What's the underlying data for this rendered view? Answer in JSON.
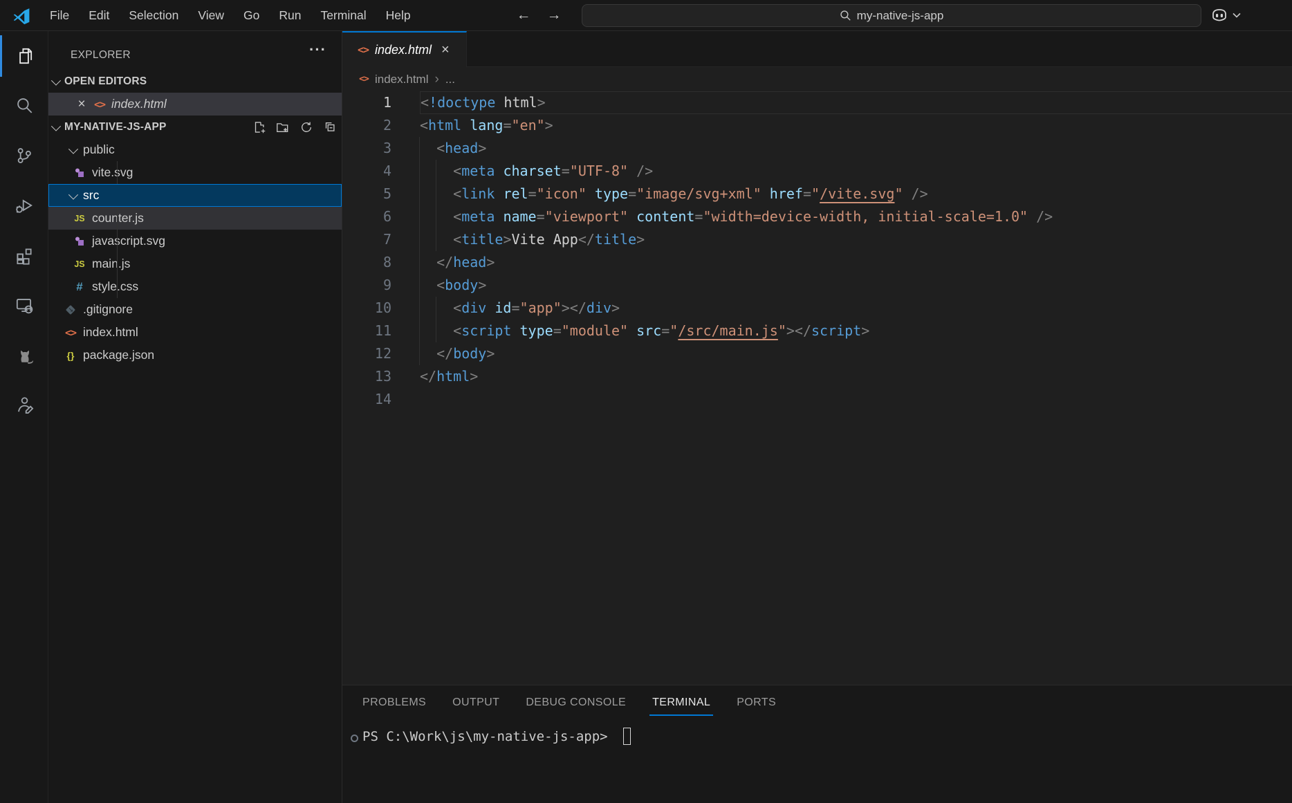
{
  "titlebar": {
    "menus": [
      "File",
      "Edit",
      "Selection",
      "View",
      "Go",
      "Run",
      "Terminal",
      "Help"
    ],
    "search_value": "my-native-js-app",
    "back_arrow": "←",
    "forward_arrow": "→"
  },
  "activity_bar": [
    {
      "name": "explorer",
      "active": true
    },
    {
      "name": "search",
      "active": false
    },
    {
      "name": "source-control",
      "active": false
    },
    {
      "name": "run-debug",
      "active": false
    },
    {
      "name": "extensions",
      "active": false
    },
    {
      "name": "remote-explorer",
      "active": false
    },
    {
      "name": "cat",
      "active": false
    },
    {
      "name": "person",
      "active": false
    }
  ],
  "sidebar": {
    "title": "EXPLORER",
    "more_actions": "···",
    "open_editors": {
      "label": "OPEN EDITORS",
      "items": [
        {
          "icon": "html",
          "label": "index.html",
          "preview": true
        }
      ]
    },
    "project": {
      "label": "MY-NATIVE-JS-APP",
      "actions": [
        "new-file",
        "new-folder",
        "refresh",
        "collapse-all"
      ],
      "tree": [
        {
          "kind": "folder",
          "icon": "chevron-down",
          "label": "public",
          "depth": 0,
          "state": ""
        },
        {
          "kind": "file",
          "icon": "svg",
          "label": "vite.svg",
          "depth": 1,
          "state": ""
        },
        {
          "kind": "folder",
          "icon": "chevron-down",
          "label": "src",
          "depth": 0,
          "state": "selected"
        },
        {
          "kind": "file",
          "icon": "js",
          "label": "counter.js",
          "depth": 1,
          "state": "highlight"
        },
        {
          "kind": "file",
          "icon": "svg",
          "label": "javascript.svg",
          "depth": 1,
          "state": ""
        },
        {
          "kind": "file",
          "icon": "js",
          "label": "main.js",
          "depth": 1,
          "state": ""
        },
        {
          "kind": "file",
          "icon": "css",
          "label": "style.css",
          "depth": 1,
          "state": ""
        },
        {
          "kind": "file",
          "icon": "git",
          "label": ".gitignore",
          "depth": 0,
          "state": ""
        },
        {
          "kind": "file",
          "icon": "html",
          "label": "index.html",
          "depth": 0,
          "state": ""
        },
        {
          "kind": "file",
          "icon": "json",
          "label": "package.json",
          "depth": 0,
          "state": ""
        }
      ]
    }
  },
  "editor": {
    "tab": {
      "icon": "html",
      "label": "index.html",
      "close": "×",
      "preview": true
    },
    "breadcrumb": {
      "icon": "html",
      "file": "index.html",
      "separator": "›",
      "more": "..."
    },
    "current_line": 1,
    "guides": {
      "3": [
        0
      ],
      "4": [
        0,
        2
      ],
      "5": [
        0,
        2
      ],
      "6": [
        0,
        2
      ],
      "7": [
        0,
        2
      ],
      "8": [
        0
      ],
      "9": [
        0
      ],
      "10": [
        0,
        2
      ],
      "11": [
        0,
        2
      ],
      "12": [
        0
      ]
    },
    "lines": [
      [
        [
          "p",
          "<"
        ],
        [
          "t",
          "!doctype"
        ],
        [
          "x",
          " html"
        ],
        [
          "p",
          ">"
        ]
      ],
      [
        [
          "p",
          "<"
        ],
        [
          "t",
          "html"
        ],
        [
          "x",
          " "
        ],
        [
          "a",
          "lang"
        ],
        [
          "p",
          "="
        ],
        [
          "s",
          "\"en\""
        ],
        [
          "p",
          ">"
        ]
      ],
      [
        [
          "x",
          "  "
        ],
        [
          "p",
          "<"
        ],
        [
          "t",
          "head"
        ],
        [
          "p",
          ">"
        ]
      ],
      [
        [
          "x",
          "    "
        ],
        [
          "p",
          "<"
        ],
        [
          "t",
          "meta"
        ],
        [
          "x",
          " "
        ],
        [
          "a",
          "charset"
        ],
        [
          "p",
          "="
        ],
        [
          "s",
          "\"UTF-8\""
        ],
        [
          "x",
          " "
        ],
        [
          "p",
          "/>"
        ]
      ],
      [
        [
          "x",
          "    "
        ],
        [
          "p",
          "<"
        ],
        [
          "t",
          "link"
        ],
        [
          "x",
          " "
        ],
        [
          "a",
          "rel"
        ],
        [
          "p",
          "="
        ],
        [
          "s",
          "\"icon\""
        ],
        [
          "x",
          " "
        ],
        [
          "a",
          "type"
        ],
        [
          "p",
          "="
        ],
        [
          "s",
          "\"image/svg+xml\""
        ],
        [
          "x",
          " "
        ],
        [
          "a",
          "href"
        ],
        [
          "p",
          "="
        ],
        [
          "s",
          "\""
        ],
        [
          "u",
          "/vite.svg"
        ],
        [
          "s",
          "\""
        ],
        [
          "x",
          " "
        ],
        [
          "p",
          "/>"
        ]
      ],
      [
        [
          "x",
          "    "
        ],
        [
          "p",
          "<"
        ],
        [
          "t",
          "meta"
        ],
        [
          "x",
          " "
        ],
        [
          "a",
          "name"
        ],
        [
          "p",
          "="
        ],
        [
          "s",
          "\"viewport\""
        ],
        [
          "x",
          " "
        ],
        [
          "a",
          "content"
        ],
        [
          "p",
          "="
        ],
        [
          "s",
          "\"width=device-width, initial-scale=1.0\""
        ],
        [
          "x",
          " "
        ],
        [
          "p",
          "/>"
        ]
      ],
      [
        [
          "x",
          "    "
        ],
        [
          "p",
          "<"
        ],
        [
          "t",
          "title"
        ],
        [
          "p",
          ">"
        ],
        [
          "x",
          "Vite App"
        ],
        [
          "p",
          "</"
        ],
        [
          "t",
          "title"
        ],
        [
          "p",
          ">"
        ]
      ],
      [
        [
          "x",
          "  "
        ],
        [
          "p",
          "</"
        ],
        [
          "t",
          "head"
        ],
        [
          "p",
          ">"
        ]
      ],
      [
        [
          "x",
          "  "
        ],
        [
          "p",
          "<"
        ],
        [
          "t",
          "body"
        ],
        [
          "p",
          ">"
        ]
      ],
      [
        [
          "x",
          "    "
        ],
        [
          "p",
          "<"
        ],
        [
          "t",
          "div"
        ],
        [
          "x",
          " "
        ],
        [
          "a",
          "id"
        ],
        [
          "p",
          "="
        ],
        [
          "s",
          "\"app\""
        ],
        [
          "p",
          "></"
        ],
        [
          "t",
          "div"
        ],
        [
          "p",
          ">"
        ]
      ],
      [
        [
          "x",
          "    "
        ],
        [
          "p",
          "<"
        ],
        [
          "t",
          "script"
        ],
        [
          "x",
          " "
        ],
        [
          "a",
          "type"
        ],
        [
          "p",
          "="
        ],
        [
          "s",
          "\"module\""
        ],
        [
          "x",
          " "
        ],
        [
          "a",
          "src"
        ],
        [
          "p",
          "="
        ],
        [
          "s",
          "\""
        ],
        [
          "u",
          "/src/main.js"
        ],
        [
          "s",
          "\""
        ],
        [
          "p",
          "></"
        ],
        [
          "t",
          "script"
        ],
        [
          "p",
          ">"
        ]
      ],
      [
        [
          "x",
          "  "
        ],
        [
          "p",
          "</"
        ],
        [
          "t",
          "body"
        ],
        [
          "p",
          ">"
        ]
      ],
      [
        [
          "p",
          "</"
        ],
        [
          "t",
          "html"
        ],
        [
          "p",
          ">"
        ]
      ],
      []
    ]
  },
  "panel": {
    "tabs": [
      {
        "label": "PROBLEMS",
        "active": false
      },
      {
        "label": "OUTPUT",
        "active": false
      },
      {
        "label": "DEBUG CONSOLE",
        "active": false
      },
      {
        "label": "TERMINAL",
        "active": true
      },
      {
        "label": "PORTS",
        "active": false
      }
    ],
    "terminal_prompt": "PS C:\\Work\\js\\my-native-js-app>"
  },
  "colors": {
    "accent": "#0078d4",
    "selection_bg": "#04395e",
    "editor_bg": "#1f1f1f",
    "chrome_bg": "#181818",
    "tag": "#569cd6",
    "attribute": "#9cdcfe",
    "string": "#ce9178",
    "punctuation": "#808080",
    "foreground": "#cccccc"
  }
}
